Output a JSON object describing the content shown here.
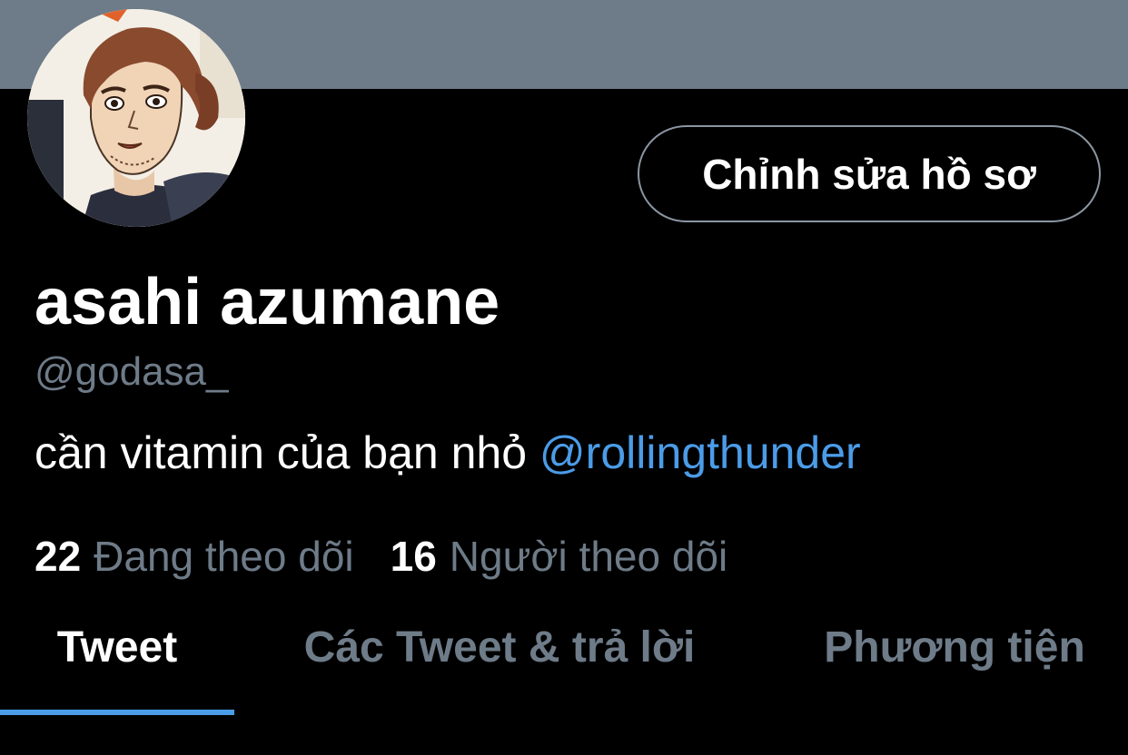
{
  "profile": {
    "display_name": "asahi azumane",
    "handle": "@godasa_",
    "bio_text": "cần vitamin của bạn nhỏ ",
    "bio_mention": "@rollingthunder",
    "edit_button_label": "Chỉnh sửa hồ sơ"
  },
  "stats": {
    "following_count": "22",
    "following_label": "Đang theo dõi",
    "followers_count": "16",
    "followers_label": "Người theo dõi"
  },
  "tabs": [
    {
      "label": "Tweet",
      "active": true
    },
    {
      "label": "Các Tweet & trả lời",
      "active": false
    },
    {
      "label": "Phương tiện",
      "active": false
    }
  ],
  "colors": {
    "banner": "#6e7b88",
    "background": "#000000",
    "accent": "#4b9ce8",
    "muted_text": "#6e7b88"
  },
  "icons": {
    "avatar": "anime-character-portrait"
  }
}
